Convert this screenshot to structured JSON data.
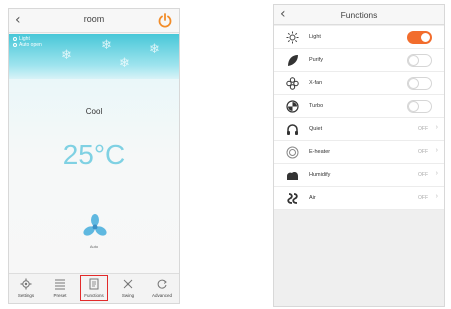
{
  "left_screen": {
    "header": {
      "back_icon": "chevron-left-icon",
      "title": "room",
      "power_icon": "power-icon",
      "power_color": "#f28c28"
    },
    "badge": {
      "line1": "Light",
      "line2": "Auto open"
    },
    "mode": "Cool",
    "temperature": "25°C",
    "fan_label": "Auto",
    "tabs": [
      {
        "label": "Settings",
        "icon": "gear-icon"
      },
      {
        "label": "Preset",
        "icon": "list-icon"
      },
      {
        "label": "Functions",
        "icon": "document-icon",
        "active": true
      },
      {
        "label": "Swing",
        "icon": "swing-icon"
      },
      {
        "label": "Advanced",
        "icon": "advanced-icon"
      }
    ],
    "colors": {
      "sky": "#48c7d8",
      "temp": "#7fd1e3",
      "active_frame": "#e22a2a"
    }
  },
  "right_screen": {
    "header": {
      "back_icon": "chevron-left-icon",
      "title": "Functions"
    },
    "items": [
      {
        "label": "Light",
        "icon": "light-icon",
        "control": "toggle",
        "on": true
      },
      {
        "label": "Purify",
        "icon": "leaf-icon",
        "control": "toggle",
        "on": false
      },
      {
        "label": "X-fan",
        "icon": "x-fan-icon",
        "control": "toggle",
        "on": false
      },
      {
        "label": "Turbo",
        "icon": "turbo-icon",
        "control": "toggle",
        "on": false
      },
      {
        "label": "Quiet",
        "icon": "headphones-icon",
        "control": "value",
        "value": "OFF"
      },
      {
        "label": "E-heater",
        "icon": "heater-icon",
        "control": "value",
        "value": "OFF"
      },
      {
        "label": "Humidify",
        "icon": "humidify-icon",
        "control": "value",
        "value": "OFF"
      },
      {
        "label": "Air",
        "icon": "air-icon",
        "control": "value",
        "value": "OFF"
      }
    ],
    "colors": {
      "toggle_on": "#f26d2d"
    }
  }
}
